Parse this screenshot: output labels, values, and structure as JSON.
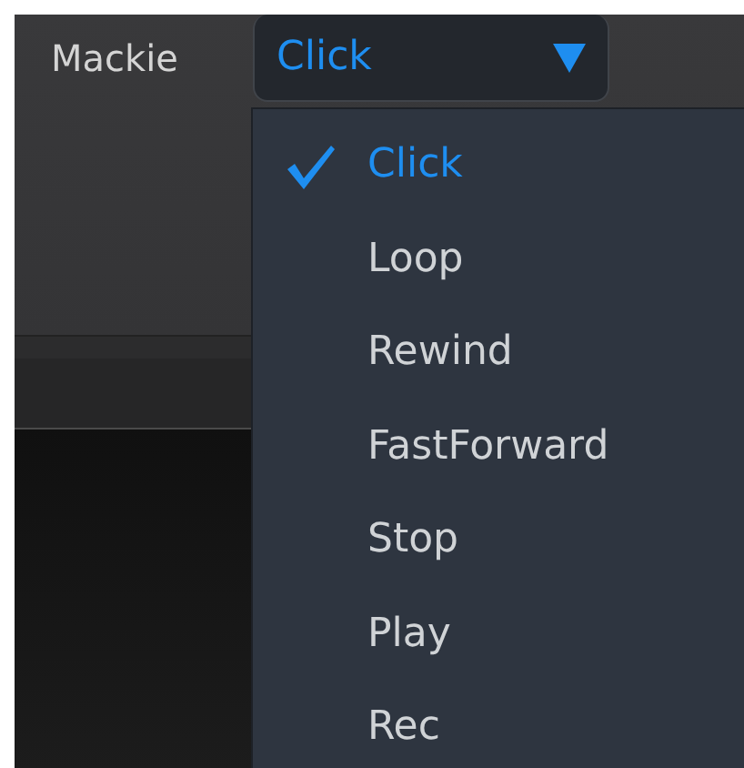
{
  "label": "Mackie",
  "dropdown": {
    "value": "Click",
    "expanded": true
  },
  "menu": {
    "items": [
      {
        "label": "Click",
        "selected": true
      },
      {
        "label": "Loop",
        "selected": false
      },
      {
        "label": "Rewind",
        "selected": false
      },
      {
        "label": "FastForward",
        "selected": false
      },
      {
        "label": "Stop",
        "selected": false
      },
      {
        "label": "Play",
        "selected": false
      },
      {
        "label": "Rec",
        "selected": false
      }
    ]
  }
}
